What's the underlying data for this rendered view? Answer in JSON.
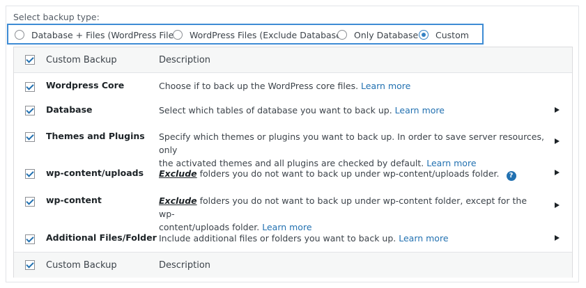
{
  "backup_type": {
    "label": "Select backup type:",
    "options": [
      {
        "label": "Database + Files (WordPress Files)",
        "checked": false
      },
      {
        "label": "WordPress Files (Exclude Database)",
        "checked": false
      },
      {
        "label": "Only Database",
        "checked": false
      },
      {
        "label": "Custom",
        "checked": true
      }
    ]
  },
  "table": {
    "header": {
      "name": "Custom Backup",
      "description": "Description"
    },
    "footer": {
      "name": "Custom Backup",
      "description": "Description"
    },
    "rows": [
      {
        "name": "Wordpress Core",
        "desc_text": "Choose if to back up the WordPress core files. ",
        "link": "Learn more"
      },
      {
        "name": "Database",
        "desc_text": "Select which tables of database you want to back up. ",
        "link": "Learn more"
      },
      {
        "name": "Themes and Plugins",
        "desc_line1": "Specify which themes or plugins you want to back up. In order to save server resources, only",
        "desc_line2": "the activated themes and all plugins are checked by default. ",
        "link": "Learn more"
      },
      {
        "name": "wp-content/uploads",
        "exclude": "Exclude",
        "desc_text": " folders you do not want to back up under wp-content/uploads folder.",
        "help": "?"
      },
      {
        "name": "wp-content",
        "exclude": "Exclude",
        "desc_line1": " folders you do not want to back up under wp-content folder, except for the wp-",
        "desc_line2": "content/uploads folder. ",
        "link": "Learn more"
      },
      {
        "name": "Additional Files/Folder",
        "desc_text": "Include additional files or folders you want to back up. ",
        "link": "Learn more"
      }
    ]
  },
  "colors": {
    "accent": "#3d8bd4",
    "link": "#2271b1",
    "header_bg": "#f6f7f7"
  }
}
